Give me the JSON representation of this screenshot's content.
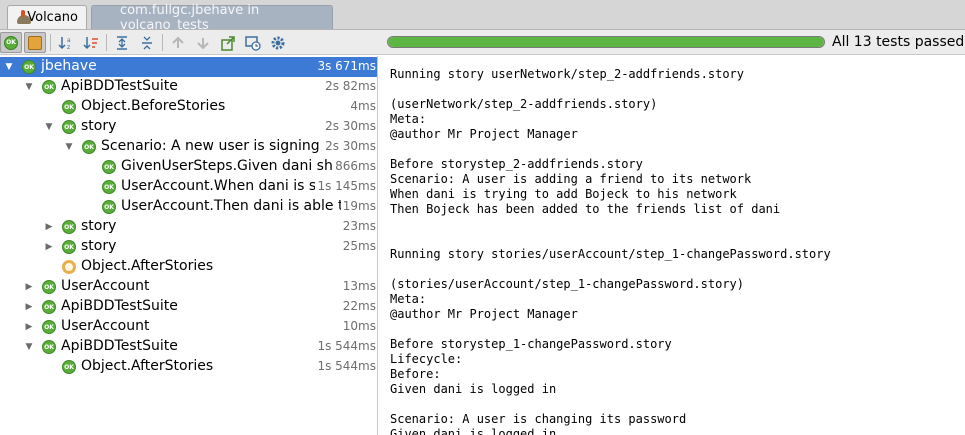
{
  "tabs": [
    {
      "label": "Volcano",
      "active": true,
      "icon": "volcano-icon"
    },
    {
      "label": "com.fullgc.jbehave in volcano_tests",
      "active": false
    }
  ],
  "toolbar": {
    "progress_percent": 100,
    "status": "All 13 tests passed -",
    "colors": {
      "pass": "#5db644",
      "selection": "#3d7ad6"
    }
  },
  "tree": [
    {
      "label": "jbehave",
      "time": "3s 671ms",
      "depth": 0,
      "expander": "expanded",
      "status": "ok",
      "selected": true
    },
    {
      "label": "ApiBDDTestSuite",
      "time": "2s 82ms",
      "depth": 1,
      "expander": "expanded",
      "status": "ok"
    },
    {
      "label": "Object.BeforeStories",
      "time": "4ms",
      "depth": 2,
      "expander": "none",
      "status": "ok"
    },
    {
      "label": "story",
      "time": "2s 30ms",
      "depth": 2,
      "expander": "expanded",
      "status": "ok"
    },
    {
      "label": "Scenario: A new user is signing up",
      "time": "2s 30ms",
      "depth": 3,
      "expander": "expanded",
      "status": "ok"
    },
    {
      "label": "GivenUserSteps.Given dani sho",
      "time": "866ms",
      "depth": 4,
      "expander": "none",
      "status": "ok"
    },
    {
      "label": "UserAccount.When dani is sign",
      "time": "1s 145ms",
      "depth": 4,
      "expander": "none",
      "status": "ok"
    },
    {
      "label": "UserAccount.Then dani is able to",
      "time": "19ms",
      "depth": 4,
      "expander": "none",
      "status": "ok"
    },
    {
      "label": "story",
      "time": "23ms",
      "depth": 2,
      "expander": "collapsed",
      "status": "ok"
    },
    {
      "label": "story",
      "time": "25ms",
      "depth": 2,
      "expander": "collapsed",
      "status": "ok"
    },
    {
      "label": "Object.AfterStories",
      "time": "",
      "depth": 2,
      "expander": "none",
      "status": "pending"
    },
    {
      "label": "UserAccount",
      "time": "13ms",
      "depth": 1,
      "expander": "collapsed",
      "status": "ok"
    },
    {
      "label": "ApiBDDTestSuite",
      "time": "22ms",
      "depth": 1,
      "expander": "collapsed",
      "status": "ok"
    },
    {
      "label": "UserAccount",
      "time": "10ms",
      "depth": 1,
      "expander": "collapsed",
      "status": "ok"
    },
    {
      "label": "ApiBDDTestSuite",
      "time": "1s 544ms",
      "depth": 1,
      "expander": "expanded",
      "status": "ok"
    },
    {
      "label": "Object.AfterStories",
      "time": "1s 544ms",
      "depth": 2,
      "expander": "none",
      "status": "ok"
    }
  ],
  "console": [
    "Running story userNetwork/step_2-addfriends.story",
    "",
    "(userNetwork/step_2-addfriends.story)",
    "Meta:",
    "@author Mr Project Manager",
    "",
    "Before storystep_2-addfriends.story",
    "Scenario: A user is adding a friend to its network",
    "When dani is trying to add Bojeck to his network",
    "Then Bojeck has been added to the friends list of dani",
    "",
    "",
    "Running story stories/userAccount/step_1-changePassword.story",
    "",
    "(stories/userAccount/step_1-changePassword.story)",
    "Meta:",
    "@author Mr Project Manager",
    "",
    "Before storystep_1-changePassword.story",
    "Lifecycle:",
    "Before:",
    "Given dani is logged in",
    "",
    "Scenario: A user is changing its password",
    "Given dani is logged in"
  ]
}
